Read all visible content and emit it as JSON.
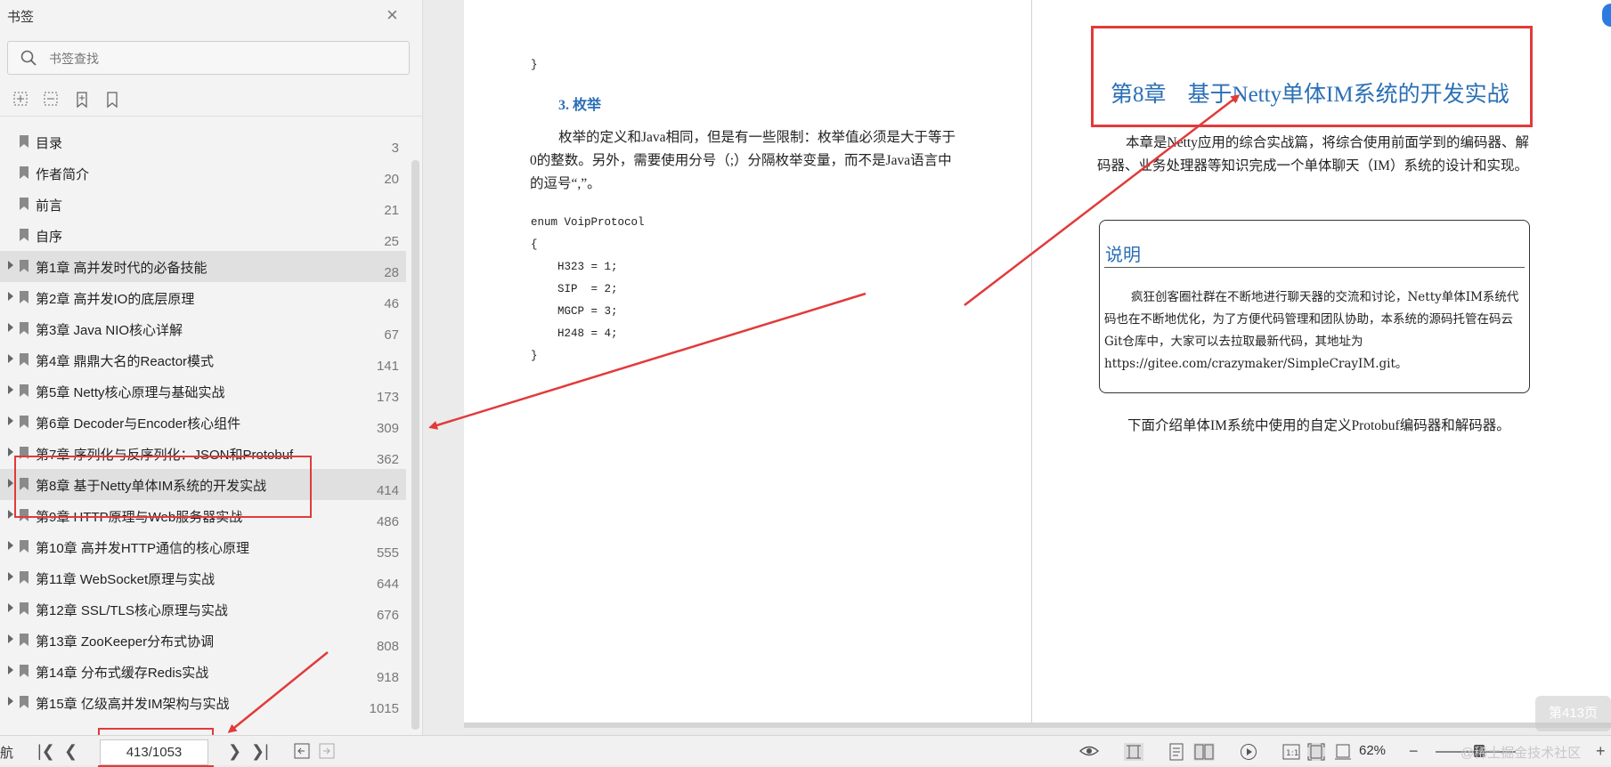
{
  "sidebar": {
    "title": "书签",
    "search_placeholder": "书签查找",
    "items": [
      {
        "label": "目录",
        "page": "3",
        "expandable": false,
        "highlight": false
      },
      {
        "label": "作者简介",
        "page": "20",
        "expandable": false,
        "highlight": false
      },
      {
        "label": "前言",
        "page": "21",
        "expandable": false,
        "highlight": false
      },
      {
        "label": "自序",
        "page": "25",
        "expandable": false,
        "highlight": false
      },
      {
        "label": "第1章 高并发时代的必备技能",
        "page": "28",
        "expandable": true,
        "highlight": true
      },
      {
        "label": "第2章 高并发IO的底层原理",
        "page": "46",
        "expandable": true,
        "highlight": false
      },
      {
        "label": "第3章 Java NIO核心详解",
        "page": "67",
        "expandable": true,
        "highlight": false
      },
      {
        "label": "第4章 鼎鼎大名的Reactor模式",
        "page": "141",
        "expandable": true,
        "highlight": false
      },
      {
        "label": "第5章 Netty核心原理与基础实战",
        "page": "173",
        "expandable": true,
        "highlight": false
      },
      {
        "label": "第6章 Decoder与Encoder核心组件",
        "page": "309",
        "expandable": true,
        "highlight": false
      },
      {
        "label": "第7章 序列化与反序列化：JSON和Protobuf",
        "page": "362",
        "expandable": true,
        "highlight": false
      },
      {
        "label": "第8章 基于Netty单体IM系统的开发实战",
        "page": "414",
        "expandable": true,
        "highlight": true
      },
      {
        "label": "第9章 HTTP原理与Web服务器实战",
        "page": "486",
        "expandable": true,
        "highlight": false
      },
      {
        "label": "第10章 高并发HTTP通信的核心原理",
        "page": "555",
        "expandable": true,
        "highlight": false
      },
      {
        "label": "第11章 WebSocket原理与实战",
        "page": "644",
        "expandable": true,
        "highlight": false
      },
      {
        "label": "第12章 SSL/TLS核心原理与实战",
        "page": "676",
        "expandable": true,
        "highlight": false
      },
      {
        "label": "第13章 ZooKeeper分布式协调",
        "page": "808",
        "expandable": true,
        "highlight": false
      },
      {
        "label": "第14章 分布式缓存Redis实战",
        "page": "918",
        "expandable": true,
        "highlight": false
      },
      {
        "label": "第15章 亿级高并发IM架构与实战",
        "page": "1015",
        "expandable": true,
        "highlight": false
      }
    ]
  },
  "left_page": {
    "code_close": "}",
    "section": "3. 枚举",
    "paragraph": "枚举的定义和Java相同，但是有一些限制：枚举值必须是大于等于0的整数。另外，需要使用分号（;）分隔枚举变量，而不是Java语言中的逗号“,”。",
    "code": [
      "enum VoipProtocol",
      "{",
      "    H323 = 1;",
      "    SIP  = 2;",
      "    MGCP = 3;",
      "    H248 = 4;",
      "}"
    ]
  },
  "right_page": {
    "chapter_no": "第8章",
    "chapter_title": "基于Netty单体IM系统的开发实战",
    "intro": "本章是Netty应用的综合实战篇，将综合使用前面学到的编码器、解码器、业务处理器等知识完成一个单体聊天（IM）系统的设计和实现。",
    "note_title": "说明",
    "note_body": "疯狂创客圈社群在不断地进行聊天器的交流和讨论，Netty单体IM系统代码也在不断地优化，为了方便代码管理和团队协助，本系统的源码托管在码云Git仓库中，大家可以去拉取最新代码，其地址为https://gitee.com/crazymaker/SimpleCrayIM.git。",
    "closing": "下面介绍单体IM系统中使用的自定义Protobuf编码器和解码器。"
  },
  "statusbar": {
    "left_fragment": "航",
    "page_indicator": "413/1053",
    "zoom": "62%",
    "watermark": "@稀土掘金技术社区"
  },
  "watermark_badge": "第413页",
  "colors": {
    "accent": "#2a6fb5",
    "annotation_red": "#e23a3a",
    "highlight_row": "#e0e0e0"
  }
}
